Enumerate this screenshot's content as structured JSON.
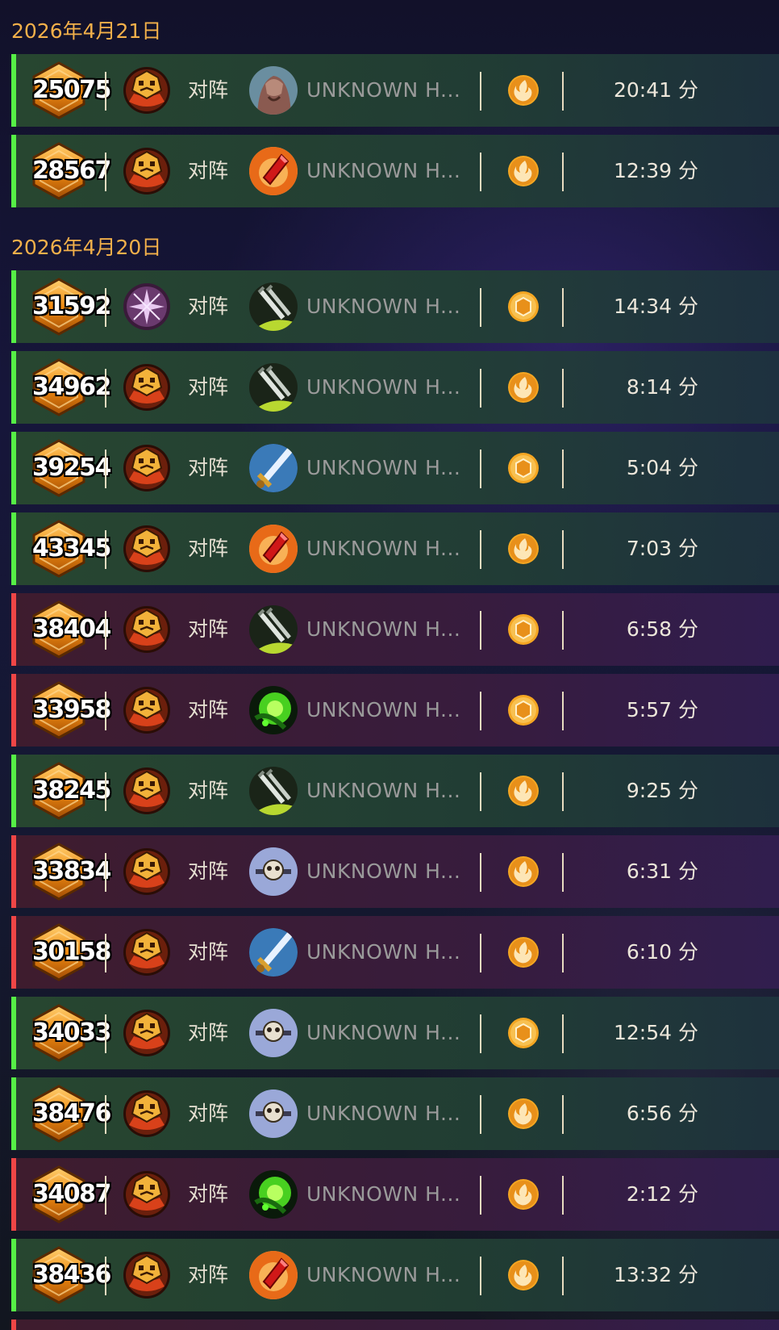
{
  "colors": {
    "date": "#f2b04a",
    "win_bar": "#56ef46",
    "loss_bar": "#ef4646",
    "score_gold": "#f0a020",
    "type_icon": "#f4a622"
  },
  "groups": [
    {
      "date": "2026年4月21日",
      "matches": [
        {
          "score": "25075",
          "result": "win",
          "mode_icon": "tavern-crest-icon",
          "vs_label": "对阵",
          "hero_icon": "beast-hero-portrait",
          "hero_name": "UNKNOWN H...",
          "type_icon": "flame-swirl-icon",
          "duration": "20:41 分"
        },
        {
          "score": "28567",
          "result": "win",
          "mode_icon": "tavern-crest-icon",
          "vs_label": "对阵",
          "hero_icon": "fire-crystal-portrait",
          "hero_name": "UNKNOWN H...",
          "type_icon": "flame-swirl-icon",
          "duration": "12:39 分"
        }
      ]
    },
    {
      "date": "2026年4月20日",
      "matches": [
        {
          "score": "31592",
          "result": "win",
          "mode_icon": "arcane-star-icon",
          "vs_label": "对阵",
          "hero_icon": "twin-blades-portrait",
          "hero_name": "UNKNOWN H...",
          "type_icon": "hexagon-coin-icon",
          "duration": "14:34 分"
        },
        {
          "score": "34962",
          "result": "win",
          "mode_icon": "tavern-crest-icon",
          "vs_label": "对阵",
          "hero_icon": "twin-blades-portrait",
          "hero_name": "UNKNOWN H...",
          "type_icon": "flame-swirl-icon",
          "duration": "8:14 分"
        },
        {
          "score": "39254",
          "result": "win",
          "mode_icon": "tavern-crest-icon",
          "vs_label": "对阵",
          "hero_icon": "blue-sword-portrait",
          "hero_name": "UNKNOWN H...",
          "type_icon": "hexagon-coin-icon",
          "duration": "5:04 分"
        },
        {
          "score": "43345",
          "result": "win",
          "mode_icon": "tavern-crest-icon",
          "vs_label": "对阵",
          "hero_icon": "fire-crystal-portrait",
          "hero_name": "UNKNOWN H...",
          "type_icon": "flame-swirl-icon",
          "duration": "7:03 分"
        },
        {
          "score": "38404",
          "result": "loss",
          "mode_icon": "tavern-crest-icon",
          "vs_label": "对阵",
          "hero_icon": "twin-blades-portrait",
          "hero_name": "UNKNOWN H...",
          "type_icon": "hexagon-coin-icon",
          "duration": "6:58 分"
        },
        {
          "score": "33958",
          "result": "loss",
          "mode_icon": "tavern-crest-icon",
          "vs_label": "对阵",
          "hero_icon": "fel-green-portrait",
          "hero_name": "UNKNOWN H...",
          "type_icon": "hexagon-coin-icon",
          "duration": "5:57 分"
        },
        {
          "score": "38245",
          "result": "win",
          "mode_icon": "tavern-crest-icon",
          "vs_label": "对阵",
          "hero_icon": "twin-blades-portrait",
          "hero_name": "UNKNOWN H...",
          "type_icon": "flame-swirl-icon",
          "duration": "9:25 分"
        },
        {
          "score": "33834",
          "result": "loss",
          "mode_icon": "tavern-crest-icon",
          "vs_label": "对阵",
          "hero_icon": "skull-shield-portrait",
          "hero_name": "UNKNOWN H...",
          "type_icon": "flame-swirl-icon",
          "duration": "6:31 分"
        },
        {
          "score": "30158",
          "result": "loss",
          "mode_icon": "tavern-crest-icon",
          "vs_label": "对阵",
          "hero_icon": "blue-sword-portrait",
          "hero_name": "UNKNOWN H...",
          "type_icon": "flame-swirl-icon",
          "duration": "6:10 分"
        },
        {
          "score": "34033",
          "result": "win",
          "mode_icon": "tavern-crest-icon",
          "vs_label": "对阵",
          "hero_icon": "skull-shield-portrait",
          "hero_name": "UNKNOWN H...",
          "type_icon": "hexagon-coin-icon",
          "duration": "12:54 分"
        },
        {
          "score": "38476",
          "result": "win",
          "mode_icon": "tavern-crest-icon",
          "vs_label": "对阵",
          "hero_icon": "skull-shield-portrait",
          "hero_name": "UNKNOWN H...",
          "type_icon": "flame-swirl-icon",
          "duration": "6:56 分"
        },
        {
          "score": "34087",
          "result": "loss",
          "mode_icon": "tavern-crest-icon",
          "vs_label": "对阵",
          "hero_icon": "fel-green-portrait",
          "hero_name": "UNKNOWN H...",
          "type_icon": "flame-swirl-icon",
          "duration": "2:12 分"
        },
        {
          "score": "38436",
          "result": "win",
          "mode_icon": "tavern-crest-icon",
          "vs_label": "对阵",
          "hero_icon": "fire-crystal-portrait",
          "hero_name": "UNKNOWN H...",
          "type_icon": "flame-swirl-icon",
          "duration": "13:32 分"
        },
        {
          "score": "",
          "result": "loss",
          "mode_icon": "",
          "vs_label": "",
          "hero_icon": "",
          "hero_name": "",
          "type_icon": "",
          "duration": ""
        }
      ]
    }
  ]
}
